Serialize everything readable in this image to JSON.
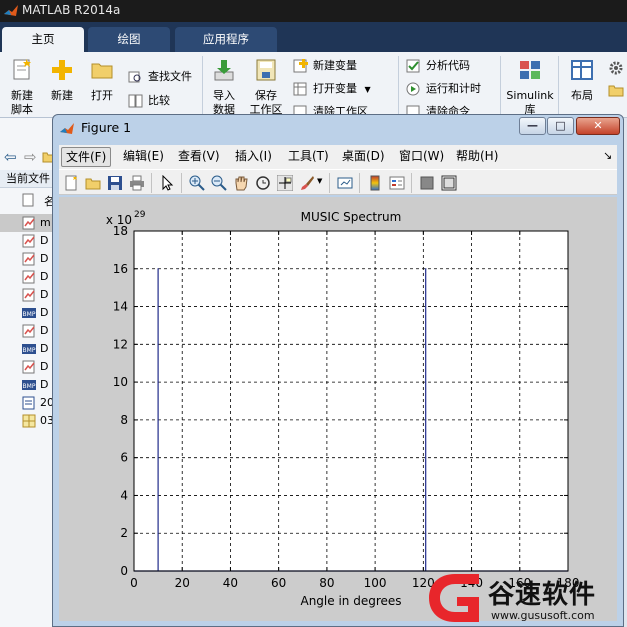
{
  "app": {
    "title": "MATLAB R2014a"
  },
  "tabs": [
    {
      "label": "主页",
      "active": true
    },
    {
      "label": "绘图",
      "active": false
    },
    {
      "label": "应用程序",
      "active": false
    }
  ],
  "ribbon": {
    "new_script": [
      "新建",
      "脚本"
    ],
    "new": "新建",
    "open": "打开",
    "find_files": "查找文件",
    "compare": "比较",
    "import_data": [
      "导入",
      "数据"
    ],
    "save_workspace": [
      "保存",
      "工作区"
    ],
    "new_variable": "新建变量",
    "open_variable": "打开变量",
    "clear_workspace": "清除工作区",
    "analyze_code": "分析代码",
    "run_and_time": "运行和计时",
    "clear_commands": "清除命令",
    "simulink": [
      "Simulink",
      "库"
    ],
    "layout": "布局"
  },
  "left_panel": {
    "current_folder": "当前文件",
    "name_header": "名",
    "files": [
      {
        "label": "m",
        "icon": "m-file-icon",
        "selected": true
      },
      {
        "label": "D",
        "icon": "m-file-icon"
      },
      {
        "label": "D",
        "icon": "m-file-icon"
      },
      {
        "label": "D",
        "icon": "m-file-icon"
      },
      {
        "label": "D",
        "icon": "m-file-icon"
      },
      {
        "label": "D",
        "icon": "bmp-file-icon"
      },
      {
        "label": "D",
        "icon": "m-file-icon"
      },
      {
        "label": "D",
        "icon": "bmp-file-icon"
      },
      {
        "label": "D",
        "icon": "m-file-icon"
      },
      {
        "label": "D",
        "icon": "bmp-file-icon"
      },
      {
        "label": "20",
        "icon": "doc-file-icon"
      },
      {
        "label": "03",
        "icon": "grid-file-icon"
      }
    ]
  },
  "figure": {
    "title": "Figure 1",
    "menu": [
      {
        "label": "文件(F)",
        "selected": true
      },
      {
        "label": "编辑(E)"
      },
      {
        "label": "查看(V)"
      },
      {
        "label": "插入(I)"
      },
      {
        "label": "工具(T)"
      },
      {
        "label": "桌面(D)"
      },
      {
        "label": "窗口(W)"
      },
      {
        "label": "帮助(H)"
      }
    ],
    "toolbar_icons": [
      "new-figure-icon",
      "open-icon",
      "save-icon",
      "print-icon",
      "pointer-icon",
      "zoom-in-icon",
      "zoom-out-icon",
      "pan-icon",
      "rotate-icon",
      "data-cursor-icon",
      "brush-icon",
      "link-icon",
      "colorbar-icon",
      "legend-icon",
      "hide-plot-tools-icon",
      "show-plot-tools-icon"
    ]
  },
  "chart_data": {
    "type": "line",
    "title": "MUSIC Spectrum",
    "xlabel": "Angle in degrees",
    "ylabel": "",
    "y_exponent_label": "x 10",
    "y_exponent": "29",
    "xlim": [
      0,
      180
    ],
    "ylim": [
      0,
      18
    ],
    "xticks": [
      0,
      20,
      40,
      60,
      80,
      100,
      120,
      140,
      160,
      180
    ],
    "yticks": [
      0,
      2,
      4,
      6,
      8,
      10,
      12,
      14,
      16,
      18
    ],
    "grid": true,
    "grid_style": "dashed",
    "line_color": "#1f2a8a",
    "series": [
      {
        "x": [
          0,
          10,
          10,
          10,
          20,
          40,
          60,
          80,
          100,
          121,
          121,
          121,
          140,
          160,
          180
        ],
        "y": [
          0,
          0,
          16,
          0,
          0,
          0,
          0,
          0,
          0,
          0,
          16,
          0,
          0,
          0,
          0
        ]
      }
    ]
  },
  "watermark": {
    "text": "谷速软件",
    "url": "www.gususoft.com"
  },
  "colors": {
    "titlebar": "#1b1b1b",
    "tab_strip": "#1f3556",
    "ribbon": "#f0f3f7",
    "figure_frame": "#bcd1e8",
    "plot_bg": "#cccccc",
    "watermark_red": "#e8262b"
  }
}
